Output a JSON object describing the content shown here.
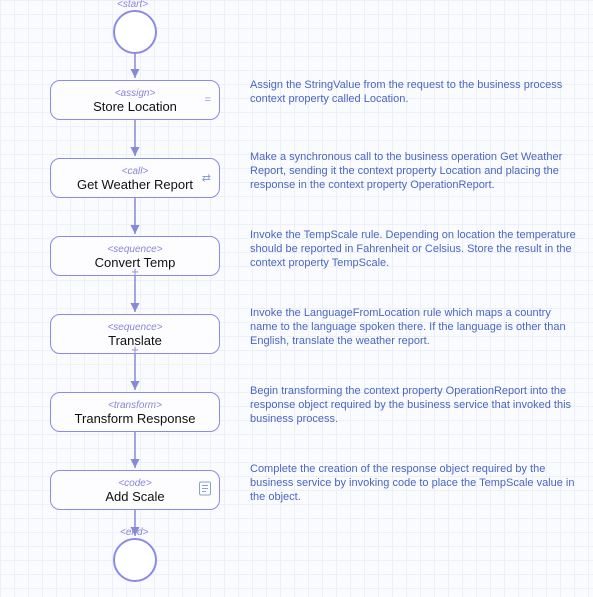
{
  "chart_data": {
    "type": "flow",
    "start": {
      "tag": "<start>"
    },
    "end": {
      "tag": "<end>"
    },
    "nodes": [
      {
        "type": "<assign>",
        "label": "Store Location",
        "icon": "assign-icon",
        "annotation": "Assign the StringValue from the request to the business process context property called Location."
      },
      {
        "type": "<call>",
        "label": "Get Weather Report",
        "icon": "call-icon",
        "annotation": "Make a synchronous call to the business operation Get Weather Report, sending it the context property Location and placing the response in the context property OperationReport."
      },
      {
        "type": "<sequence>",
        "label": "Convert Temp",
        "icon": "plus-icon",
        "annotation": "Invoke the TempScale rule. Depending on location the temperature should be reported in Fahrenheit or Celsius. Store the result in the context property TempScale."
      },
      {
        "type": "<sequence>",
        "label": "Translate",
        "icon": "plus-icon",
        "annotation": "Invoke the LanguageFromLocation rule which maps a country name to the language spoken there. If the language is other than English, translate the weather report."
      },
      {
        "type": "<transform>",
        "label": "Transform Response",
        "icon": "transform-icon",
        "annotation": "Begin transforming the context property OperationReport into the response object required by the business service that invoked this business process."
      },
      {
        "type": "<code>",
        "label": "Add Scale",
        "icon": "code-icon",
        "annotation": "Complete the creation of the response object required by the business service by invoking code to place the TempScale value in the object."
      }
    ]
  }
}
